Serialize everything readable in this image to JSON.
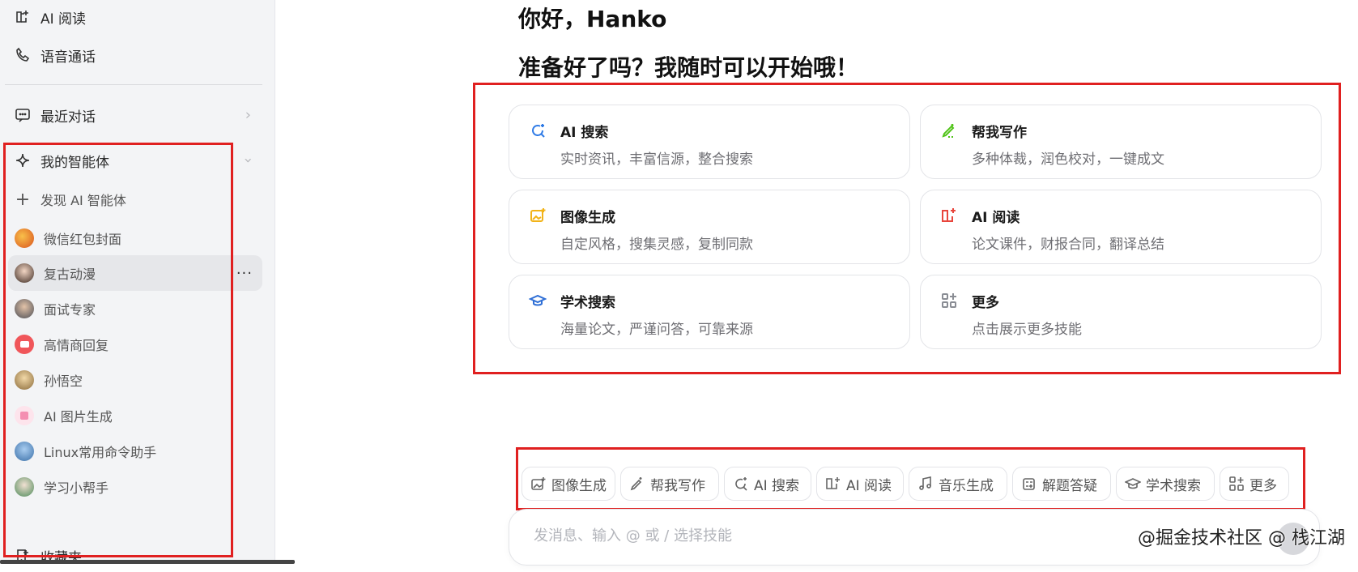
{
  "sidebar": {
    "top_items": [
      {
        "label": "AI 阅读",
        "icon": "book-icon"
      },
      {
        "label": "语音通话",
        "icon": "phone-icon"
      }
    ],
    "recent": {
      "label": "最近对话",
      "icon": "chat-icon"
    },
    "agents_section": {
      "label": "我的智能体",
      "icon": "sparkle-icon",
      "discover_label": "发现 AI 智能体",
      "items": [
        {
          "label": "微信红包封面",
          "color": "#f08a2c"
        },
        {
          "label": "复古动漫",
          "color": "#6b4a3a"
        },
        {
          "label": "面试专家",
          "color": "#5b5f6a"
        },
        {
          "label": "高情商回复",
          "color": "#f0565a"
        },
        {
          "label": "孙悟空",
          "color": "#c9a06a"
        },
        {
          "label": "AI 图片生成",
          "color": "#f7c8d5"
        },
        {
          "label": "Linux常用命令助手",
          "color": "#6aa0d8"
        },
        {
          "label": "学习小帮手",
          "color": "#7fb88a"
        }
      ],
      "active_more": "···"
    },
    "favorites": {
      "label": "收藏夹",
      "icon": "bookmark-icon"
    }
  },
  "main": {
    "greeting": "你好，Hanko",
    "prompt": "准备好了吗？我随时可以开始哦！",
    "cards": [
      {
        "title": "AI 搜索",
        "sub": "实时资讯，丰富信源，整合搜索",
        "icon": "search-icon",
        "color": "#2f7be6"
      },
      {
        "title": "帮我写作",
        "sub": "多种体裁，润色校对，一键成文",
        "icon": "pen-icon",
        "color": "#52c41a"
      },
      {
        "title": "图像生成",
        "sub": "自定风格，搜集灵感，复制同款",
        "icon": "image-icon",
        "color": "#f2b318"
      },
      {
        "title": "AI 阅读",
        "sub": "论文课件，财报合同，翻译总结",
        "icon": "book-icon",
        "color": "#e8453c"
      },
      {
        "title": "学术搜索",
        "sub": "海量论文，严谨问答，可靠来源",
        "icon": "graduation-icon",
        "color": "#2f6fd6"
      },
      {
        "title": "更多",
        "sub": "点击展示更多技能",
        "icon": "grid-icon",
        "color": "#8a8d94"
      }
    ],
    "chips": [
      {
        "label": "图像生成",
        "icon": "image-icon"
      },
      {
        "label": "帮我写作",
        "icon": "pen-icon"
      },
      {
        "label": "AI 搜索",
        "icon": "search-icon"
      },
      {
        "label": "AI 阅读",
        "icon": "book-icon"
      },
      {
        "label": "音乐生成",
        "icon": "music-icon"
      },
      {
        "label": "解题答疑",
        "icon": "calculator-icon"
      },
      {
        "label": "学术搜索",
        "icon": "graduation-icon"
      },
      {
        "label": "更多",
        "icon": "grid-icon"
      }
    ],
    "input_placeholder": "发消息、输入 @ 或 / 选择技能"
  },
  "watermark": "@掘金技术社区 @ 栈江湖",
  "annotation_color": "#e02020"
}
